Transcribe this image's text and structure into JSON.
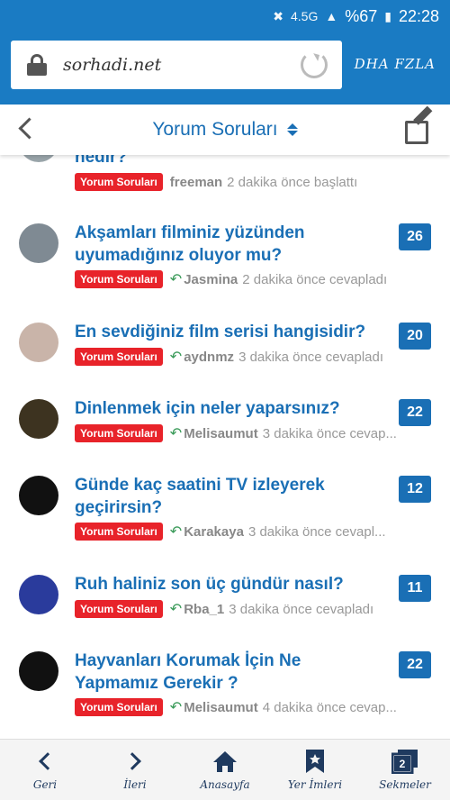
{
  "statusbar": {
    "signal_label": "4.5G",
    "battery": "%67",
    "time": "22:28"
  },
  "browser": {
    "url": "sorhadi.net",
    "more_label": "DHA FZLA"
  },
  "header": {
    "title": "Yorum Soruları"
  },
  "topics": [
    {
      "title": "Dizin d...nedir?",
      "title_visible": "nedir?",
      "badge": "Yorum Soruları",
      "user": "freeman",
      "when": "2 dakika önce başlattı",
      "count": "",
      "avatar_color": "#9aa5aa"
    },
    {
      "title": "Akşamları filminiz yüzünden uyumadığınız oluyor mu?",
      "badge": "Yorum Soruları",
      "user": "Jasmina",
      "when": "2 dakika önce cevapladı",
      "count": "26",
      "avatar_color": "#7f8a93"
    },
    {
      "title": "En sevdiğiniz film serisi hangisidir?",
      "badge": "Yorum Soruları",
      "user": "aydnmz",
      "when": "3 dakika önce cevapladı",
      "count": "20",
      "avatar_color": "#c9b4a9"
    },
    {
      "title": "Dinlenmek için neler yaparsınız?",
      "badge": "Yorum Soruları",
      "user": "Melisaumut",
      "when": "3 dakika önce cevap...",
      "count": "22",
      "avatar_color": "#3d3320"
    },
    {
      "title": "Günde kaç saatini TV izleyerek geçirirsin?",
      "badge": "Yorum Soruları",
      "user": "Karakaya",
      "when": "3 dakika önce cevapl...",
      "count": "12",
      "avatar_color": "#111111"
    },
    {
      "title": "Ruh haliniz son üç gündür nasıl?",
      "badge": "Yorum Soruları",
      "user": "Rba_1",
      "when": "3 dakika önce cevapladı",
      "count": "11",
      "avatar_color": "#2a3b9c"
    },
    {
      "title": "Hayvanları Korumak İçin Ne Yapmamız Gerekir ?",
      "badge": "Yorum Soruları",
      "user": "Melisaumut",
      "when": "4 dakika önce cevap...",
      "count": "22",
      "avatar_color": "#111111"
    }
  ],
  "bottomnav": {
    "back": "Geri",
    "forward": "İleri",
    "home": "Anasayfa",
    "bookmarks": "Yer İmleri",
    "tabs": "Sekmeler",
    "tabs_count": "2"
  },
  "colors": {
    "brand": "#1a7bc3",
    "link": "#1a6fb5",
    "badge": "#e8232a",
    "reply": "#3b9b5a"
  }
}
